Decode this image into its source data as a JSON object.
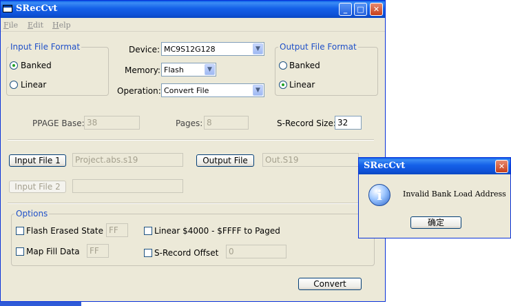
{
  "main_window": {
    "title": "SRecCvt",
    "menu": [
      "File",
      "Edit",
      "Help"
    ]
  },
  "input_format": {
    "label": "Input File Format",
    "options": [
      {
        "label": "Banked",
        "selected": true
      },
      {
        "label": "Linear",
        "selected": false
      }
    ]
  },
  "output_format": {
    "label": "Output File Format",
    "options": [
      {
        "label": "Banked",
        "selected": false
      },
      {
        "label": "Linear",
        "selected": true
      }
    ]
  },
  "device": {
    "label": "Device:",
    "value": "MC9S12G128"
  },
  "memory": {
    "label": "Memory:",
    "value": "Flash"
  },
  "operation": {
    "label": "Operation:",
    "value": "Convert File"
  },
  "ppage_base": {
    "label": "PPAGE Base:",
    "value": "38"
  },
  "pages": {
    "label": "Pages:",
    "value": "8"
  },
  "srecord_size": {
    "label": "S-Record Size:",
    "value": "32"
  },
  "input_file_1": {
    "button": "Input File 1",
    "value": "Project.abs.s19"
  },
  "output_file": {
    "button": "Output File",
    "value": "Out.S19"
  },
  "input_file_2": {
    "button": "Input File 2",
    "value": ""
  },
  "options": {
    "label": "Options",
    "flash_erased_state": {
      "label": "Flash Erased State",
      "value": "FF",
      "checked": false
    },
    "map_fill_data": {
      "label": "Map Fill Data",
      "value": "FF",
      "checked": false
    },
    "linear_to_paged": {
      "label": "Linear $4000 - $FFFF to Paged",
      "checked": false
    },
    "srecord_offset": {
      "label": "S-Record Offset",
      "value": "0",
      "checked": false
    }
  },
  "convert_button": "Convert",
  "dialog": {
    "title": "SRecCvt",
    "icon": "info-icon",
    "message": "Invalid Bank Load Address",
    "ok_button": "确定"
  },
  "colors": {
    "title_bar": "#0f52d8",
    "window_bg": "#ece9d8",
    "group_label": "#1e4fc8",
    "close_button": "#c6401c"
  }
}
